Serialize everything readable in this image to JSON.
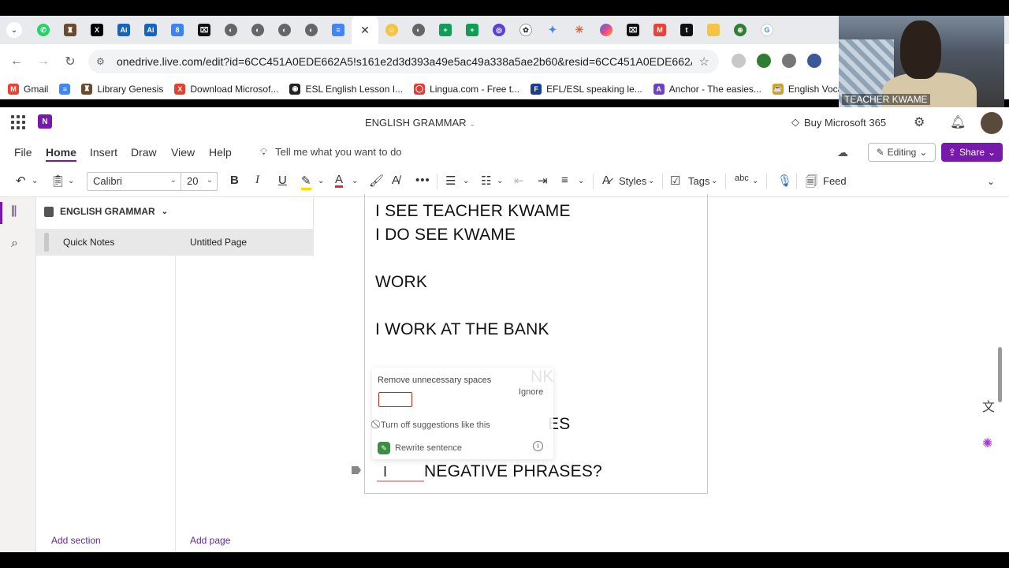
{
  "browser": {
    "url": "onedrive.live.com/edit?id=6CC451A0EDE662A5!s161e2d3d393a49e5ac49a338a5ae2b60&resid=6CC451A0EDE662A5!s161e2...",
    "bookmarks": [
      {
        "label": "Gmail",
        "color": "#ea4335",
        "glyph": "M"
      },
      {
        "label": "",
        "color": "#4285f4",
        "glyph": "≡"
      },
      {
        "label": "Library Genesis",
        "color": "#6b4b2b",
        "glyph": "♜"
      },
      {
        "label": "Download Microsof...",
        "color": "#e2412f",
        "glyph": "X"
      },
      {
        "label": "ESL English Lesson I...",
        "color": "#222222",
        "glyph": "◉"
      },
      {
        "label": "Lingua.com - Free t...",
        "color": "#e53935",
        "glyph": "◯"
      },
      {
        "label": "EFL/ESL speaking le...",
        "color": "#1a3e8f",
        "glyph": "F"
      },
      {
        "label": "Anchor - The easies...",
        "color": "#6f42c1",
        "glyph": "A"
      },
      {
        "label": "English Vocabulary f...",
        "color": "#c9a227",
        "glyph": "☕"
      }
    ]
  },
  "app": {
    "title": "ENGLISH GRAMMAR",
    "buy_label": "Buy Microsoft 365",
    "tabs": [
      "File",
      "Home",
      "Insert",
      "Draw",
      "View",
      "Help"
    ],
    "active_tab": "Home",
    "tell_me": "Tell me what you want to do",
    "editing_label": "Editing",
    "share_label": "Share"
  },
  "ribbon": {
    "font_name": "Calibri",
    "font_size": "20",
    "styles_label": "Styles",
    "tags_label": "Tags",
    "feed_label": "Feed"
  },
  "nav": {
    "notebook": "ENGLISH GRAMMAR",
    "section": "Quick Notes",
    "page": "Untitled Page",
    "add_section": "Add section",
    "add_page": "Add page"
  },
  "note": {
    "lines": [
      "I SEE TEACHER KWAME",
      "I DO SEE KWAME",
      "WORK",
      "I WORK AT THE BANK",
      "NK",
      "ES",
      "NEGATIVE PHRASES?"
    ]
  },
  "suggestion": {
    "title": "Remove unnecessary spaces",
    "ignore": "Ignore",
    "turn_off": "Turn off suggestions like this",
    "rewrite": "Rewrite sentence"
  },
  "webcam": {
    "caption": "TEACHER KWAME"
  }
}
